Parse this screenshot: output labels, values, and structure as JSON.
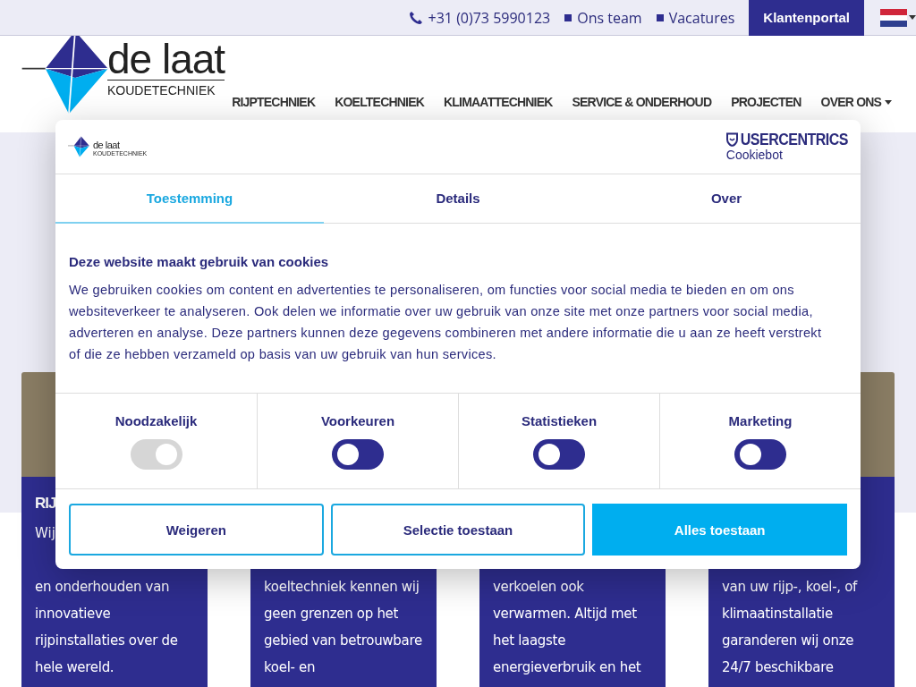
{
  "top_bar": {
    "phone": "+31 (0)73 5990123",
    "links": [
      "Ons team",
      "Vacatures"
    ],
    "portal_button": "Klantenportal"
  },
  "header": {
    "logo": {
      "name": "de laat",
      "tagline": "KOUDETECHNIEK"
    },
    "nav": [
      {
        "label": "RIJPTECHNIEK",
        "has_dropdown": false
      },
      {
        "label": "KOELTECHNIEK",
        "has_dropdown": false
      },
      {
        "label": "KLIMAATTECHNIEK",
        "has_dropdown": false
      },
      {
        "label": "SERVICE & ONDERHOUD",
        "has_dropdown": false
      },
      {
        "label": "PROJECTEN",
        "has_dropdown": false
      },
      {
        "label": "OVER ONS",
        "has_dropdown": true
      }
    ]
  },
  "cards": [
    {
      "heading": "RIJ",
      "lead": "Wij",
      "text": "en onderhouden van innovatieve rijpinstallaties over de hele wereld."
    },
    {
      "text": "koeltechniek kennen wij geen grenzen op het gebied van betrouwbare koel- en"
    },
    {
      "text": "verkoelen ook verwarmen. Altijd met het laagste energieverbruik en het"
    },
    {
      "text": "van uw rijp-, koel-, of klimaatinstallatie garanderen wij onze 24/7 beschikbare"
    }
  ],
  "cookie_dialog": {
    "logo": {
      "name": "de laat",
      "tagline": "KOUDETECHNIEK"
    },
    "provider": {
      "name": "USERCENTRICS",
      "product": "Cookiebot"
    },
    "tabs": [
      {
        "label": "Toestemming",
        "selected": true
      },
      {
        "label": "Details",
        "selected": false
      },
      {
        "label": "Over",
        "selected": false
      }
    ],
    "title": "Deze website maakt gebruik van cookies",
    "text": "We gebruiken cookies om content en advertenties te personaliseren, om functies voor social media te bieden en om ons websiteverkeer te analyseren. Ook delen we informatie over uw gebruik van onze site met onze partners voor social media, adverteren en analyse. Deze partners kunnen deze gegevens combineren met andere informatie die u aan ze heeft verstrekt of die ze hebben verzameld op basis van uw gebruik van hun services.",
    "toggles": [
      {
        "label": "Noodzakelijk",
        "checked": true,
        "disabled": true
      },
      {
        "label": "Voorkeuren",
        "checked": false,
        "disabled": false
      },
      {
        "label": "Statistieken",
        "checked": false,
        "disabled": false
      },
      {
        "label": "Marketing",
        "checked": false,
        "disabled": false
      }
    ],
    "buttons": [
      {
        "label": "Weigeren",
        "kind": "outline"
      },
      {
        "label": "Selectie toestaan",
        "kind": "outline"
      },
      {
        "label": "Alles toestaan",
        "kind": "primary"
      }
    ]
  }
}
